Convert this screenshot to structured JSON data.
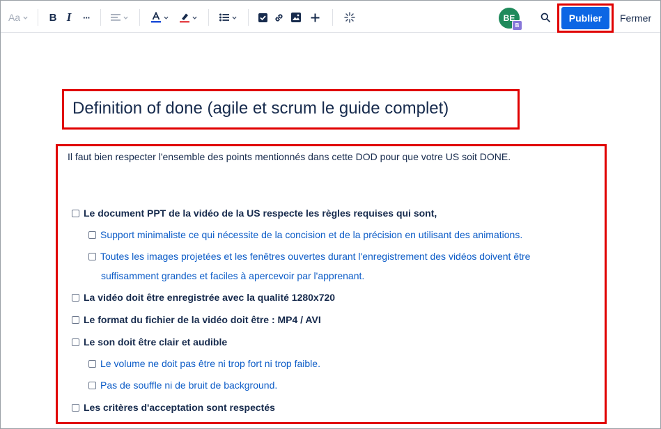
{
  "toolbar": {
    "text_style_label": "Aa",
    "bold_label": "B",
    "italic_label": "I",
    "more_label": "···",
    "avatar_initials": "BE",
    "avatar_badge": "B",
    "publish_label": "Publier",
    "close_label": "Fermer"
  },
  "colors": {
    "publish": "#0c66e4",
    "highlight_outline": "#e00000",
    "avatar": "#1f8a5b",
    "link_text": "#0c5cc7"
  },
  "page": {
    "title": "Definition of done (agile et scrum le guide complet)",
    "intro": "Il faut bien respecter l'ensemble des points mentionnés dans cette DOD pour que votre US soit DONE."
  },
  "checklist": [
    {
      "text": "Le document PPT de la vidéo de la US respecte les règles requises qui sont,"
    },
    {
      "text": "Support minimaliste ce qui nécessite de la concision et de la précision en utilisant des animations."
    },
    {
      "text": "Toutes les images projetées et les fenêtres ouvertes durant l'enregistrement des vidéos doivent être"
    },
    {
      "text": "suffisamment grandes et faciles à apercevoir par l'apprenant."
    },
    {
      "text": "La vidéo doit être enregistrée avec la qualité 1280x720"
    },
    {
      "text": "Le format du fichier de la vidéo doit être : MP4  / AVI"
    },
    {
      "text": "Le son doit être clair et audible"
    },
    {
      "text": "Le volume ne doit pas être ni trop fort ni trop faible."
    },
    {
      "text": "Pas de souffle ni de bruit de background."
    },
    {
      "text": "Les critères d'acceptation sont respectés"
    }
  ]
}
